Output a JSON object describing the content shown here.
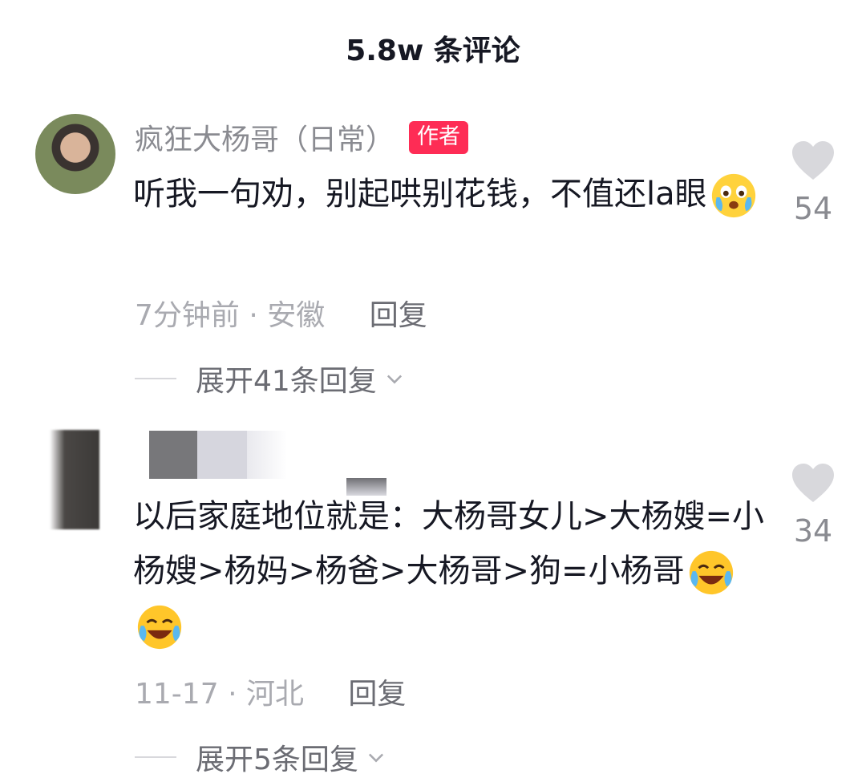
{
  "header": {
    "title": "5.8w 条评论"
  },
  "comments": [
    {
      "username": "疯狂大杨哥（日常）",
      "badge": "作者",
      "text": "听我一句劝，别起哄别花钱，不值还la眼",
      "emoji": "crying-emoji",
      "time": "7分钟前",
      "location": "安徽",
      "reply_label": "回复",
      "expand_label": "展开41条回复",
      "likes": "54"
    },
    {
      "username": "",
      "text": "以后家庭地位就是：大杨哥女儿>大杨嫂=小杨嫂>杨妈>杨爸>大杨哥>狗=小杨哥",
      "emoji": "laughing-crying-emoji",
      "time": "11-17",
      "location": "河北",
      "reply_label": "回复",
      "expand_label": "展开5条回复",
      "likes": "34"
    }
  ],
  "icons": {
    "like": "heart-icon",
    "expand": "chevron-down-icon"
  },
  "colors": {
    "badge": "#fe2c55",
    "muted": "#a9aab0",
    "text": "#161823"
  }
}
